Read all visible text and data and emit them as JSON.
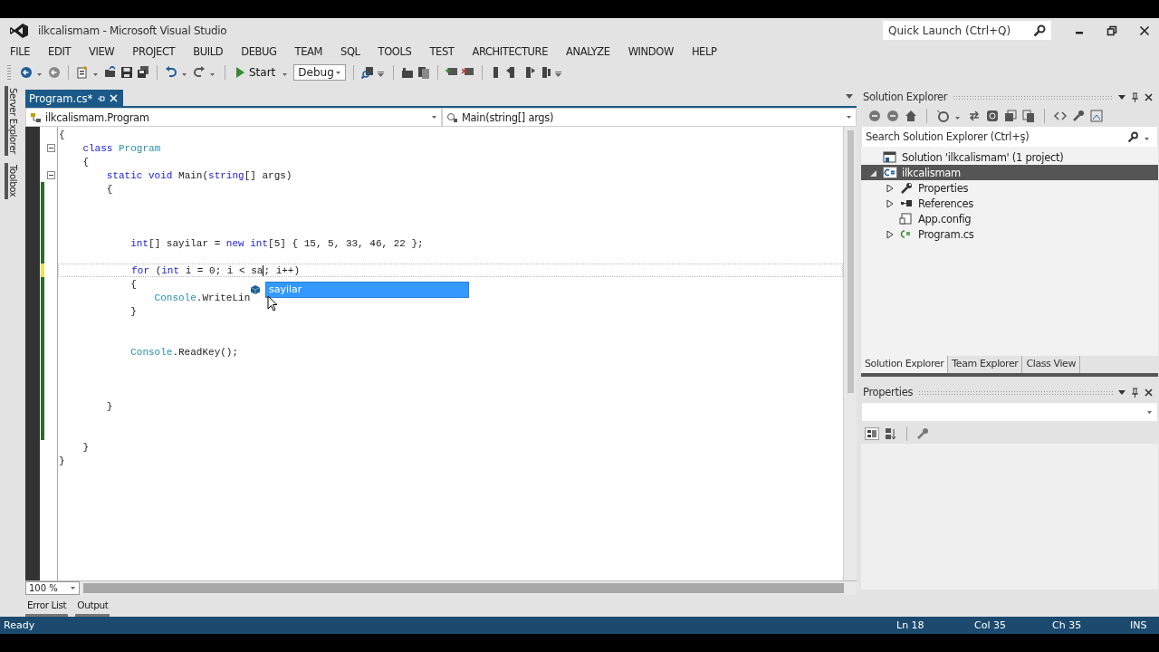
{
  "window": {
    "title": "ilkcalismam - Microsoft Visual Studio",
    "quick_launch": {
      "placeholder": "Quick Launch (Ctrl+Q)"
    }
  },
  "menu": [
    "FILE",
    "EDIT",
    "VIEW",
    "PROJECT",
    "BUILD",
    "DEBUG",
    "TEAM",
    "SQL",
    "TOOLS",
    "TEST",
    "ARCHITECTURE",
    "ANALYZE",
    "WINDOW",
    "HELP"
  ],
  "toolbar": {
    "start_button": "Start",
    "configuration": "Debug"
  },
  "side_tabs": [
    "Server Explorer",
    "Toolbox"
  ],
  "editor": {
    "tabs": [
      {
        "label": "Program.cs*",
        "selected": true
      }
    ],
    "type_nav": "ilkcalismam.Program",
    "member_nav": "Main(string[] args)",
    "lines": [
      {
        "tokens": [
          {
            "kind": "plain",
            "t": "{"
          }
        ]
      },
      {
        "folded": false,
        "tokens": [
          {
            "kind": "keyword",
            "t": "    class"
          },
          {
            "kind": "type",
            "t": " Program"
          }
        ]
      },
      {
        "tokens": [
          {
            "kind": "plain",
            "t": "    {"
          }
        ]
      },
      {
        "folded": false,
        "tokens": [
          {
            "kind": "keyword",
            "t": "        static"
          },
          {
            "kind": "keyword",
            "t": " void"
          },
          {
            "kind": "plain",
            "t": " Main("
          },
          {
            "kind": "keyword",
            "t": "string"
          },
          {
            "kind": "plain",
            "t": "[] args)"
          }
        ]
      },
      {
        "modified": true,
        "saved": true,
        "tokens": [
          {
            "kind": "plain",
            "t": "        {"
          }
        ]
      },
      {
        "modified": true,
        "saved": true
      },
      {
        "modified": true,
        "saved": true
      },
      {
        "modified": true,
        "saved": true
      },
      {
        "modified": true,
        "saved": true,
        "tokens": [
          {
            "kind": "keyword",
            "t": "            int"
          },
          {
            "kind": "plain",
            "t": "[] sayilar = "
          },
          {
            "kind": "keyword",
            "t": "new"
          },
          {
            "kind": "keyword",
            "t": " int"
          },
          {
            "kind": "plain",
            "t": "[5] { 15, 5, 33, 46, 22 };"
          }
        ]
      },
      {
        "modified": true,
        "saved": true
      },
      {
        "modified": true,
        "saved": false,
        "current": true,
        "tokens": [
          {
            "kind": "keyword",
            "t": "            for"
          },
          {
            "kind": "plain",
            "t": " ("
          },
          {
            "kind": "keyword",
            "t": "int"
          },
          {
            "kind": "plain",
            "t": " i = 0; i < sa",
            "caret": true
          },
          {
            "kind": "plain",
            "t": "; i++)"
          }
        ]
      },
      {
        "modified": true,
        "saved": true,
        "tokens": [
          {
            "kind": "plain",
            "t": "            {"
          }
        ]
      },
      {
        "modified": true,
        "saved": true,
        "tokens": [
          {
            "kind": "type",
            "t": "                Console"
          },
          {
            "kind": "plain",
            "t": ".WriteLin"
          }
        ]
      },
      {
        "modified": true,
        "saved": true,
        "tokens": [
          {
            "kind": "plain",
            "t": "            }"
          }
        ]
      },
      {
        "modified": true,
        "saved": true
      },
      {
        "modified": true,
        "saved": true
      },
      {
        "modified": true,
        "saved": true,
        "tokens": [
          {
            "kind": "type",
            "t": "            Console"
          },
          {
            "kind": "plain",
            "t": ".ReadKey();"
          }
        ]
      },
      {
        "modified": true,
        "saved": true
      },
      {
        "modified": true,
        "saved": true
      },
      {
        "modified": true,
        "saved": true
      },
      {
        "modified": true,
        "saved": true,
        "tokens": [
          {
            "kind": "plain",
            "t": "        }"
          }
        ]
      },
      {
        "modified": true,
        "saved": true
      },
      {
        "modified": true,
        "saved": true
      },
      {
        "tokens": [
          {
            "kind": "plain",
            "t": "    }"
          }
        ]
      },
      {
        "tokens": [
          {
            "kind": "plain",
            "t": "}"
          }
        ]
      }
    ],
    "completion": {
      "items": [
        {
          "label": "sayilar",
          "selected": true
        }
      ]
    },
    "zoom": "100 %"
  },
  "bottom_tabs": [
    "Error List",
    "Output"
  ],
  "solution_explorer": {
    "title": "Solution Explorer",
    "search": {
      "placeholder": "Search Solution Explorer (Ctrl+ş)"
    },
    "tree": [
      {
        "label": "Solution 'ilkcalismam' (1 project)",
        "kind": "solution",
        "selected": false,
        "children": [
          {
            "label": "ilkcalismam",
            "kind": "project",
            "expanded": true,
            "selected": true,
            "children": [
              {
                "label": "Properties",
                "kind": "properties",
                "expanded": false,
                "selected": false
              },
              {
                "label": "References",
                "kind": "references",
                "expanded": false,
                "selected": false
              },
              {
                "label": "App.config",
                "kind": "config",
                "selected": false
              },
              {
                "label": "Program.cs",
                "kind": "csharp",
                "expanded": false,
                "selected": false
              }
            ]
          }
        ]
      }
    ],
    "tabs": [
      {
        "label": "Solution Explorer",
        "selected": true
      },
      {
        "label": "Team Explorer",
        "selected": false
      },
      {
        "label": "Class View",
        "selected": false
      }
    ]
  },
  "properties": {
    "title": "Properties"
  },
  "status_bar": {
    "message": "Ready",
    "line": "Ln 18",
    "column": "Col 35",
    "char": "Ch 35",
    "mode": "INS"
  }
}
